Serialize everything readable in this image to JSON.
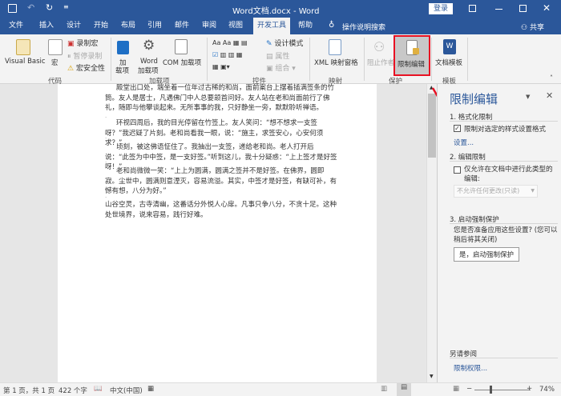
{
  "titlebar": {
    "title": "Word文档.docx  -  Word",
    "login": "登录"
  },
  "tabs": [
    {
      "label": "文件"
    },
    {
      "label": "插入"
    },
    {
      "label": "设计"
    },
    {
      "label": "开始"
    },
    {
      "label": "布局"
    },
    {
      "label": "引用"
    },
    {
      "label": "邮件"
    },
    {
      "label": "审阅"
    },
    {
      "label": "视图"
    },
    {
      "label": "开发工具",
      "active": true
    },
    {
      "label": "帮助"
    }
  ],
  "tell_me": "操作说明搜索",
  "share": "共享",
  "ribbon": {
    "code": {
      "label": "代码",
      "visual_basic": "Visual Basic",
      "macros": "宏",
      "record_macro": "录制宏",
      "pause_recording": "暂停录制",
      "macro_security": "宏安全性"
    },
    "addins": {
      "label": "加载项",
      "addins_1": "加",
      "addins_2": "载项",
      "word_addins_1": "Word",
      "word_addins_2": "加载项",
      "com_addins": "COM 加载项"
    },
    "controls": {
      "label": "控件",
      "design_mode": "设计模式",
      "properties": "属性",
      "group": "组合"
    },
    "mapping": {
      "label": "映射",
      "xml_pane": "XML 映射窗格"
    },
    "protect": {
      "label": "保护",
      "block_authors": "阻止作者",
      "restrict_editing": "限制编辑"
    },
    "templates": {
      "label": "模板",
      "doc_template": "文档模板"
    }
  },
  "document": {
    "paragraphs": [
      "殿堂出口处，端坐着一位年过古稀的和尚，面前案台上摆着插满签条的竹筒。友人是居士，凡遇佛门中人总要颔首问好。友人站在老和尚面前行了佛礼，随即与他攀谈起来。无所事事的我，只好静坐一旁，默默聆听禅语。",
      "环视四周后，我的目光停留在竹签上。友人笑问：“想不想求一支签呀？”我迟疑了片刻。老和尚看我一眼，说：“施主，求签安心，心安何须求？”",
      "顷刻，被这佛语怔住了。我抽出一支签，递给老和尚。老人打开后说：“此签为中中签，是一支好签。”听到这儿，我十分疑惑：“上上签才是好签呀！”",
      "老和尚微微一笑：“上上为圆满，圆满之签并不是好签。在佛界，圆即寂。尘世中，圆满则意湮灭，容易流溢。其实，中签才是好签，有缺可补，有憾有想，八分为好。”",
      "山谷空灵，古寺清幽，这番话分外悦人心扉。凡事只争八分，不贪十足。这种处世境界，说来容易，践行好难。"
    ]
  },
  "pane": {
    "title": "限制编辑",
    "s1_title": "1. 格式化限制",
    "s1_checkbox": "限制对选定的样式设置格式",
    "s1_checked": true,
    "s1_link": "设置...",
    "s2_title": "2. 编辑限制",
    "s2_checkbox": "仅允许在文档中进行此类型的编辑:",
    "s2_checked": false,
    "s2_select": "不允许任何更改(只读)",
    "s3_title": "3. 启动强制保护",
    "s3_text": "您是否准备应用这些设置? (您可以稍后将其关闭)",
    "s3_button": "是，启动强制保护",
    "see_also": "另请参阅",
    "permissions_link": "限制权限..."
  },
  "status": {
    "page": "第 1 页，共 1 页",
    "words": "422 个字",
    "language": "中文(中国)",
    "zoom": "74%",
    "zoom_level": 74
  },
  "colors": {
    "accent": "#2b579a",
    "highlight": "#e81123",
    "link": "#2b579a"
  }
}
